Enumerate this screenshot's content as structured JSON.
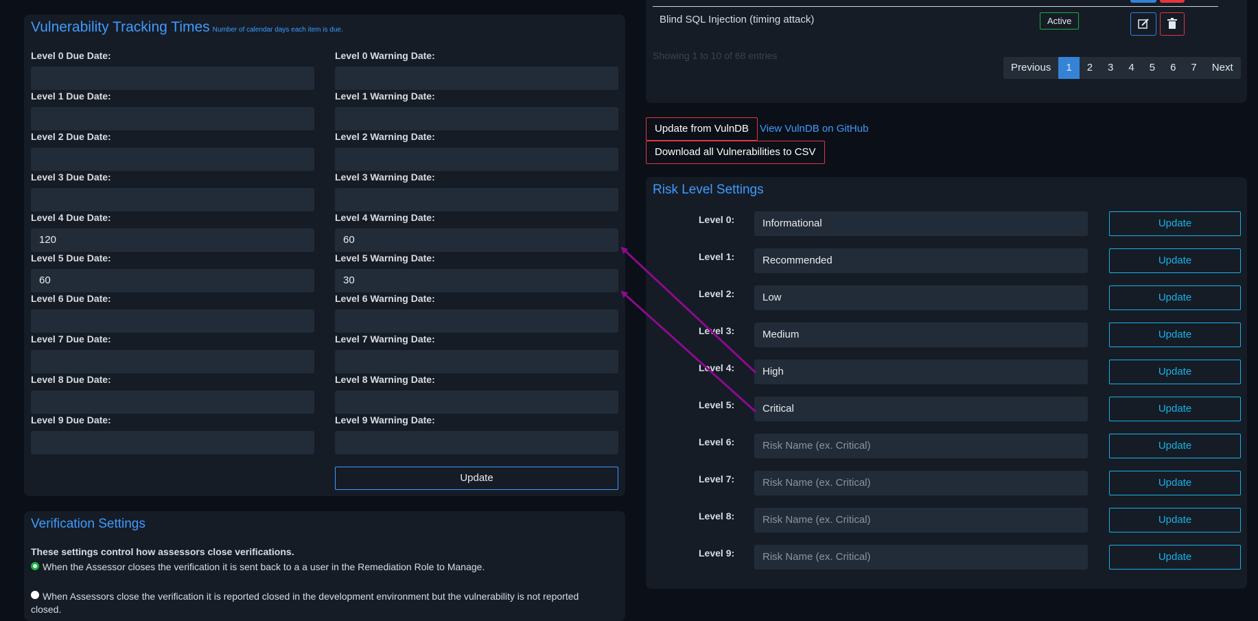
{
  "vuln_times": {
    "title": "Vulnerability Tracking Times",
    "subtitle": "Number of calendar days each item is due.",
    "rows": [
      {
        "due_label": "Level 0 Due Date:",
        "due_value": "",
        "warn_label": "Level 0 Warning Date:",
        "warn_value": ""
      },
      {
        "due_label": "Level 1 Due Date:",
        "due_value": "",
        "warn_label": "Level 1 Warning Date:",
        "warn_value": ""
      },
      {
        "due_label": "Level 2 Due Date:",
        "due_value": "",
        "warn_label": "Level 2 Warning Date:",
        "warn_value": ""
      },
      {
        "due_label": "Level 3 Due Date:",
        "due_value": "",
        "warn_label": "Level 3 Warning Date:",
        "warn_value": ""
      },
      {
        "due_label": "Level 4 Due Date:",
        "due_value": "120",
        "warn_label": "Level 4 Warning Date:",
        "warn_value": "60"
      },
      {
        "due_label": "Level 5 Due Date:",
        "due_value": "60",
        "warn_label": "Level 5 Warning Date:",
        "warn_value": "30"
      },
      {
        "due_label": "Level 6 Due Date:",
        "due_value": "",
        "warn_label": "Level 6 Warning Date:",
        "warn_value": ""
      },
      {
        "due_label": "Level 7 Due Date:",
        "due_value": "",
        "warn_label": "Level 7 Warning Date:",
        "warn_value": ""
      },
      {
        "due_label": "Level 8 Due Date:",
        "due_value": "",
        "warn_label": "Level 8 Warning Date:",
        "warn_value": ""
      },
      {
        "due_label": "Level 9 Due Date:",
        "due_value": "",
        "warn_label": "Level 9 Warning Date:",
        "warn_value": ""
      }
    ],
    "update_label": "Update"
  },
  "verification": {
    "title": "Verification Settings",
    "intro": "These settings control how assessors close verifications.",
    "option1": "When the Assessor closes the verification it is sent back to a a user in the Remediation Role to Manage.",
    "option2": "When Assessors close the verification it is reported closed in the development environment but the vulnerability is not reported",
    "option2_cont": "closed."
  },
  "vuln_table": {
    "last_row_name": "Blind SQL Injection (timing attack)",
    "last_row_status": "Active",
    "showing_text": "Showing 1 to 10 of 68 entries",
    "pagination": {
      "previous": "Previous",
      "pages": [
        "1",
        "2",
        "3",
        "4",
        "5",
        "6",
        "7"
      ],
      "next": "Next",
      "active": "1"
    }
  },
  "vulndb": {
    "update_button": "Update from VulnDB",
    "github_link": "View VulnDB on GitHub",
    "download_button": "Download all Vulnerabilities to CSV"
  },
  "risk_levels": {
    "title": "Risk Level Settings",
    "placeholder": "Risk Name (ex. Critical)",
    "update_label": "Update",
    "levels": [
      {
        "label": "Level 0:",
        "value": "Informational"
      },
      {
        "label": "Level 1:",
        "value": "Recommended"
      },
      {
        "label": "Level 2:",
        "value": "Low"
      },
      {
        "label": "Level 3:",
        "value": "Medium"
      },
      {
        "label": "Level 4:",
        "value": "High"
      },
      {
        "label": "Level 5:",
        "value": "Critical"
      },
      {
        "label": "Level 6:",
        "value": ""
      },
      {
        "label": "Level 7:",
        "value": ""
      },
      {
        "label": "Level 8:",
        "value": ""
      },
      {
        "label": "Level 9:",
        "value": ""
      }
    ]
  },
  "colors": {
    "accent": "#3f9bff",
    "update_outline": "#1ab1e6",
    "danger": "#e2373e",
    "active_badge": "#1fae3d",
    "annotation_arrow": "#8e0a8e"
  }
}
